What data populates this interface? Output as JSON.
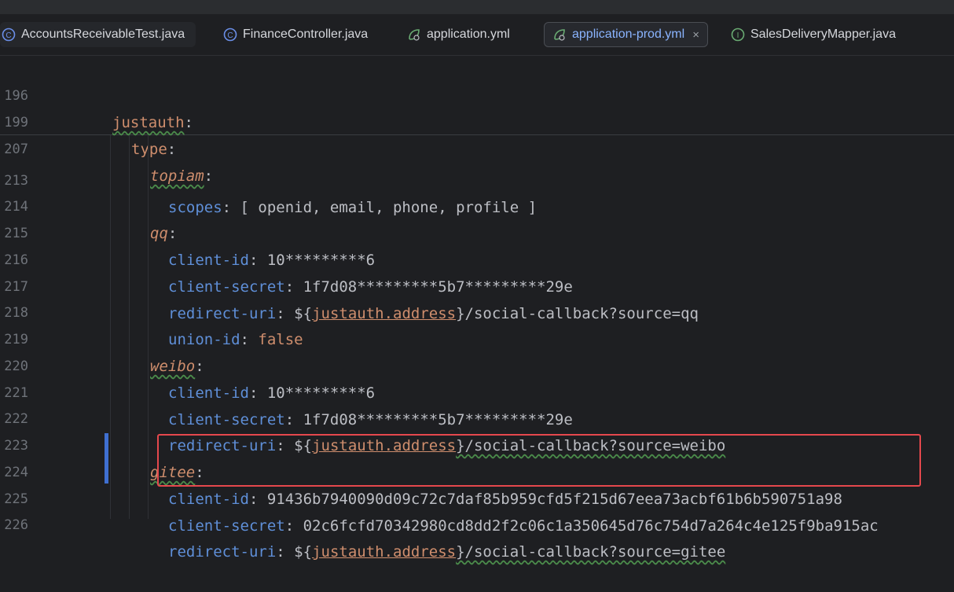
{
  "tabs": [
    {
      "label": "AccountsReceivableTest.java",
      "icon": "class-icon"
    },
    {
      "label": "FinanceController.java",
      "icon": "class-icon"
    },
    {
      "label": "application.yml",
      "icon": "yaml-leaf-icon"
    },
    {
      "label": "application-prod.yml",
      "icon": "yaml-leaf-icon",
      "active": true,
      "close": "×"
    },
    {
      "label": "SalesDeliveryMapper.java",
      "icon": "interface-icon"
    }
  ],
  "sticky": [
    {
      "ln": "196",
      "key": "justauth",
      "sep": ":"
    },
    {
      "ln": "199",
      "key": "type",
      "sep": ":"
    },
    {
      "ln": "207",
      "key": "topiam",
      "sep": ":"
    }
  ],
  "lines": [
    {
      "ln": "213",
      "key": "scopes",
      "sep": ": ",
      "value": "[ openid, email, phone, profile ]"
    },
    {
      "ln": "214",
      "key": "qq",
      "sep": ":"
    },
    {
      "ln": "215",
      "key": "client-id",
      "sep": ": ",
      "value": "10*********6"
    },
    {
      "ln": "216",
      "key": "client-secret",
      "sep": ": ",
      "value": "1f7d08*********5b7*********29e"
    },
    {
      "ln": "217",
      "key": "redirect-uri",
      "sep": ": ",
      "pre": "${",
      "ref": "justauth.address",
      "post": "}/social-callback?source=qq"
    },
    {
      "ln": "218",
      "key": "union-id",
      "sep": ": ",
      "value": "false"
    },
    {
      "ln": "219",
      "key": "weibo",
      "sep": ":"
    },
    {
      "ln": "220",
      "key": "client-id",
      "sep": ": ",
      "value": "10*********6"
    },
    {
      "ln": "221",
      "key": "client-secret",
      "sep": ": ",
      "value": "1f7d08*********5b7*********29e"
    },
    {
      "ln": "222",
      "key": "redirect-uri",
      "sep": ": ",
      "pre": "${",
      "ref": "justauth.address",
      "post": "}/social-callback?source=weibo"
    },
    {
      "ln": "223",
      "key": "gitee",
      "sep": ":"
    },
    {
      "ln": "224",
      "key": "client-id",
      "sep": ": ",
      "value": "91436b7940090d09c72c7daf85b959cfd5f215d67eea73acbf61b6b590751a98"
    },
    {
      "ln": "225",
      "key": "client-secret",
      "sep": ": ",
      "value": "02c6fcfd70342980cd8dd2f2c06c1a350645d76c754d7a264c4e125f9ba915ac"
    },
    {
      "ln": "226",
      "key": "redirect-uri",
      "sep": ": ",
      "pre": "${",
      "ref": "justauth.address",
      "post": "}/social-callback?source=gitee"
    }
  ]
}
